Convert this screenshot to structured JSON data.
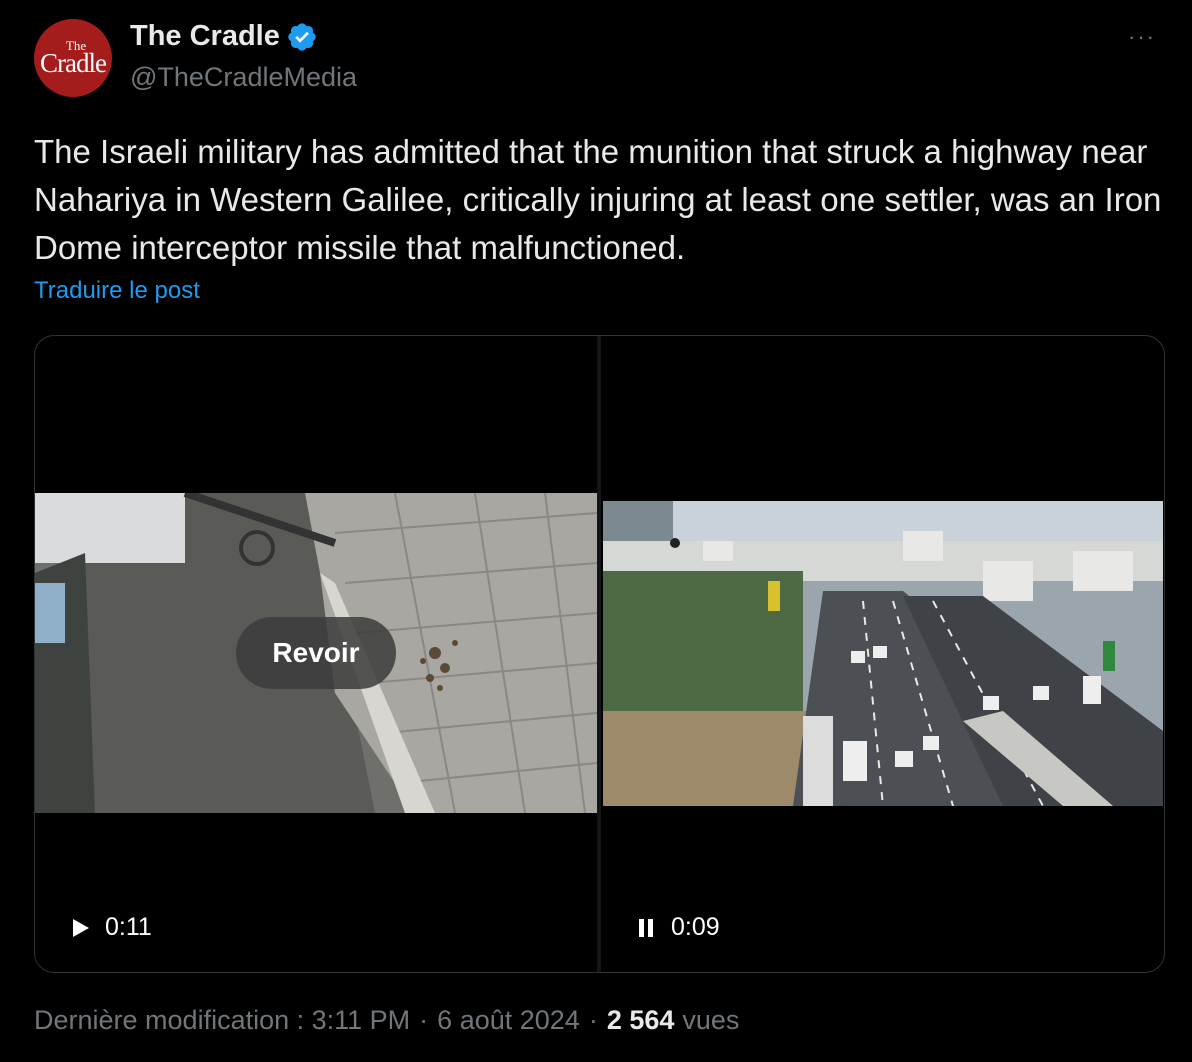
{
  "author": {
    "avatar_text_small": "The",
    "avatar_text_large": "Cradle",
    "display_name": "The Cradle",
    "handle": "@TheCradleMedia",
    "verified": true
  },
  "menu": {
    "more_label": "···"
  },
  "tweet": {
    "text": "The Israeli military has admitted that the munition that struck a highway near Nahariya in Western Galilee, critically injuring at least one settler, was an Iron Dome interceptor missile that malfunctioned.",
    "translate_label": "Traduire le post"
  },
  "media": {
    "videos": [
      {
        "replay_label": "Revoir",
        "state": "play",
        "duration": "0:11"
      },
      {
        "state": "pause",
        "duration": "0:09"
      }
    ]
  },
  "meta": {
    "edited_label": "Dernière modification : 3:11 PM",
    "date": "6 août 2024",
    "views_count": "2 564",
    "views_label": "vues",
    "separator": "·"
  },
  "colors": {
    "background": "#000000",
    "text": "#e7e9ea",
    "secondary": "#71767b",
    "link": "#1d9bf0",
    "verified": "#1d9bf0",
    "avatar": "#a51c1c"
  }
}
